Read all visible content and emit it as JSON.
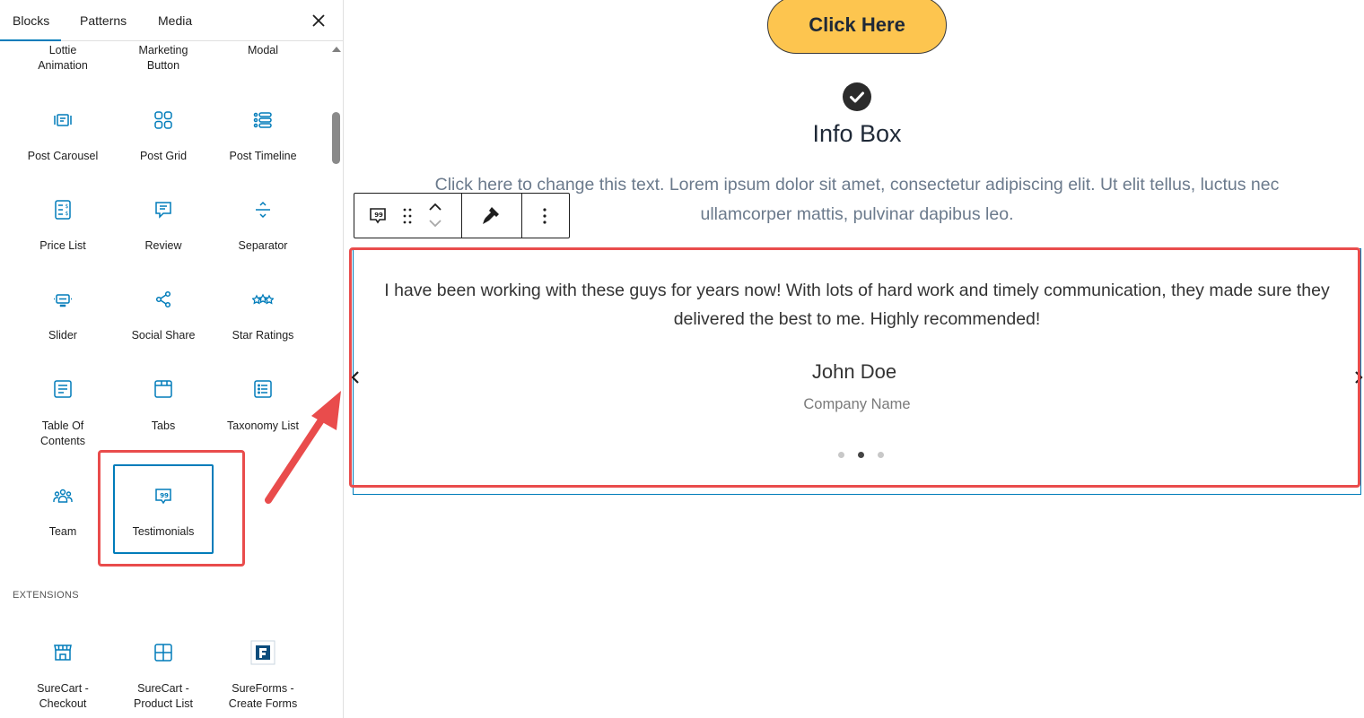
{
  "sidebar": {
    "tabs": [
      {
        "label": "Blocks"
      },
      {
        "label": "Patterns"
      },
      {
        "label": "Media"
      }
    ],
    "blocks": [
      {
        "label": "Lottie\nAnimation",
        "icon": "lottie-icon"
      },
      {
        "label": "Marketing\nButton",
        "icon": "marketing-button-icon"
      },
      {
        "label": "Modal",
        "icon": "modal-icon"
      },
      {
        "label": "Post Carousel",
        "icon": "post-carousel-icon"
      },
      {
        "label": "Post Grid",
        "icon": "post-grid-icon"
      },
      {
        "label": "Post Timeline",
        "icon": "post-timeline-icon"
      },
      {
        "label": "Price List",
        "icon": "price-list-icon"
      },
      {
        "label": "Review",
        "icon": "review-icon"
      },
      {
        "label": "Separator",
        "icon": "separator-icon"
      },
      {
        "label": "Slider",
        "icon": "slider-icon"
      },
      {
        "label": "Social Share",
        "icon": "social-share-icon"
      },
      {
        "label": "Star Ratings",
        "icon": "star-ratings-icon"
      },
      {
        "label": "Table Of\nContents",
        "icon": "table-of-contents-icon"
      },
      {
        "label": "Tabs",
        "icon": "tabs-icon"
      },
      {
        "label": "Taxonomy List",
        "icon": "taxonomy-list-icon"
      },
      {
        "label": "Team",
        "icon": "team-icon"
      },
      {
        "label": "Testimonials",
        "icon": "testimonials-icon"
      }
    ],
    "extensions_heading": "EXTENSIONS",
    "extensions": [
      {
        "label": "SureCart -\nCheckout",
        "icon": "store-icon"
      },
      {
        "label": "SureCart -\nProduct List",
        "icon": "grid-icon"
      },
      {
        "label": "SureForms -\nCreate Forms",
        "icon": "sureforms-icon"
      }
    ]
  },
  "canvas": {
    "button_label": "Click Here",
    "info_box": {
      "title": "Info Box",
      "text": "Click here to change this text. Lorem ipsum dolor sit amet, consectetur adipiscing elit. Ut elit tellus, luctus nec ullamcorper mattis, pulvinar dapibus leo."
    },
    "testimonial": {
      "quote": "I have been working with these guys for years now! With lots of hard work and timely communication, they made sure they delivered the best to me. Highly recommended!",
      "name": "John Doe",
      "company": "Company Name",
      "slide_count": 3,
      "active_slide": 2
    }
  },
  "colors": {
    "accent": "#007cba",
    "button": "#fdc54f",
    "annotation": "#e94c4c"
  }
}
